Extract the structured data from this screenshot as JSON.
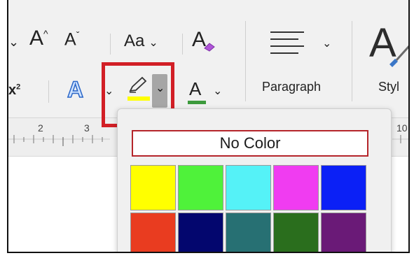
{
  "ribbon": {
    "row1": {
      "grow_font": "A",
      "shrink_font": "A",
      "change_case": "Aa",
      "clear_formatting": "A"
    },
    "row2": {
      "superscript_base": "x",
      "superscript_exp": "2",
      "text_effects": "A",
      "font_color": "A"
    },
    "paragraph_label": "Paragraph",
    "styles_label": "Styl",
    "highlight_color": "#ffff00",
    "font_color_value": "#3c9a3c"
  },
  "ruler": {
    "marks": [
      "2",
      "3",
      "10"
    ]
  },
  "popup": {
    "no_color_label": "No Color",
    "swatches": [
      {
        "name": "yellow",
        "color": "#ffff00"
      },
      {
        "name": "bright-green",
        "color": "#4ff23a"
      },
      {
        "name": "turquoise",
        "color": "#55f2f7"
      },
      {
        "name": "pink",
        "color": "#f03cf1"
      },
      {
        "name": "blue",
        "color": "#0b20f6"
      },
      {
        "name": "red",
        "color": "#e93c20"
      },
      {
        "name": "dark-blue",
        "color": "#03066e"
      },
      {
        "name": "teal",
        "color": "#277073"
      },
      {
        "name": "green",
        "color": "#2a6e1d"
      },
      {
        "name": "violet",
        "color": "#6a1a77"
      }
    ]
  }
}
